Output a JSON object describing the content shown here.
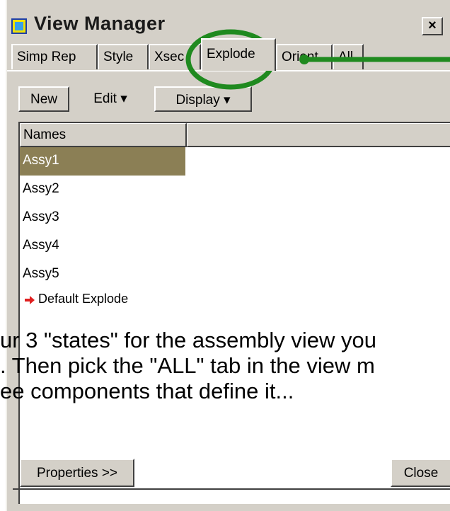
{
  "window": {
    "title": "View Manager",
    "close_label": "×"
  },
  "tabs": [
    {
      "label": "Simp Rep"
    },
    {
      "label": "Style"
    },
    {
      "label": "Xsec"
    },
    {
      "label": "Explode",
      "active": true
    },
    {
      "label": "Orient"
    },
    {
      "label": "All"
    }
  ],
  "toolbar": {
    "new_label": "New",
    "edit_label": "Edit ▾",
    "display_label": "Display ▾"
  },
  "list": {
    "header": "Names",
    "items": [
      {
        "label": "Assy1",
        "selected": true
      },
      {
        "label": "Assy2"
      },
      {
        "label": "Assy3"
      },
      {
        "label": "Assy4"
      },
      {
        "label": "Assy5"
      }
    ],
    "default_item": "Default Explode"
  },
  "overlay": {
    "line1": "ur 3 \"states\" for the assembly view you",
    "line2": ". Then pick the \"ALL\" tab in the view m",
    "line3": "ee components that define it..."
  },
  "footer": {
    "properties_label": "Properties >>",
    "close_label": "Close"
  },
  "colors": {
    "selection": "#8b7f55",
    "annotation": "#1f8a1f",
    "default_arrow": "#e02020"
  },
  "icons": {
    "title_icon": "view-manager-icon",
    "default_item_icon": "red-arrow-icon"
  }
}
